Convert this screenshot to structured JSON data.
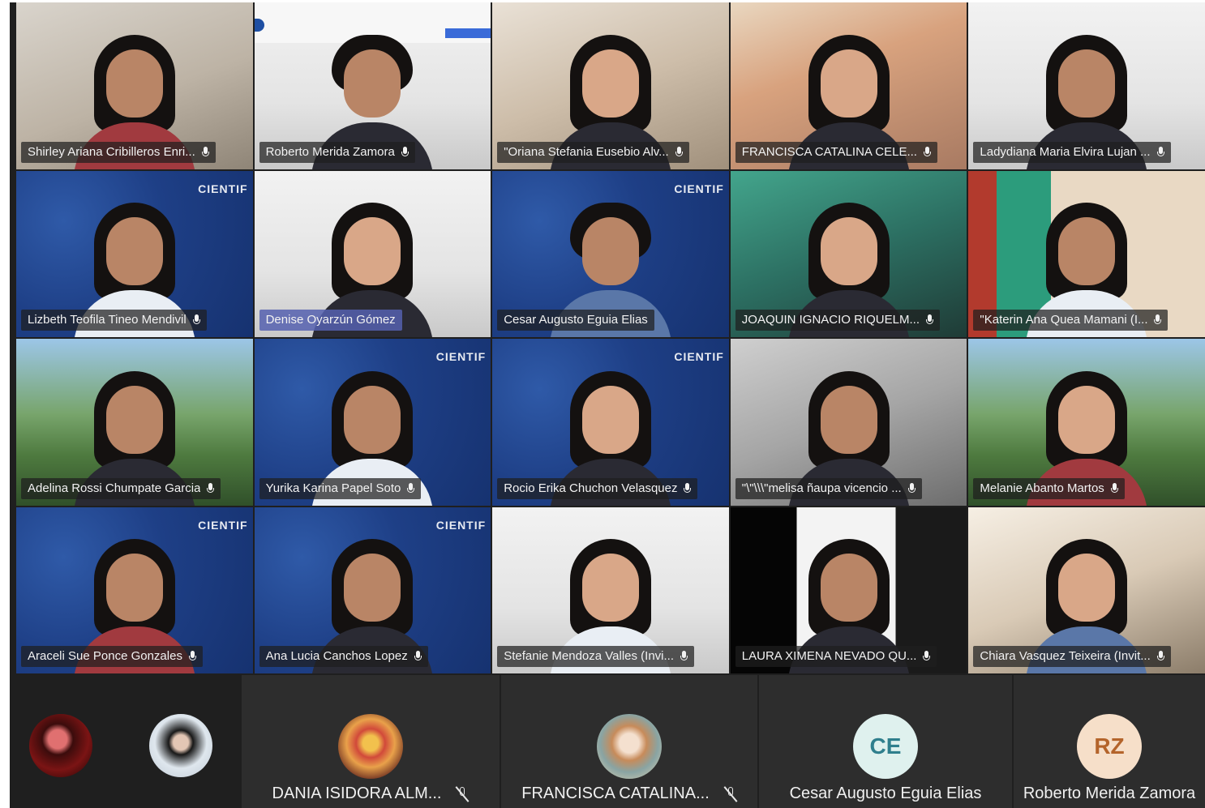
{
  "participants": [
    {
      "name": "Shirley Ariana Cribilleros Enri...",
      "highlight": false
    },
    {
      "name": "Roberto Merida Zamora",
      "highlight": false
    },
    {
      "name": "\"Oriana Stefania Eusebio Alv...",
      "highlight": false
    },
    {
      "name": "FRANCISCA CATALINA CELE...",
      "highlight": false
    },
    {
      "name": "Ladydiana Maria Elvira Lujan ...",
      "highlight": false
    },
    {
      "name": "Lizbeth Teofila Tineo Mendivil",
      "highlight": false
    },
    {
      "name": "Denise Oyarzún Gómez",
      "highlight": true
    },
    {
      "name": "Cesar Augusto Eguia Elias",
      "highlight": false
    },
    {
      "name": "JOAQUIN IGNACIO RIQUELM...",
      "highlight": false
    },
    {
      "name": "\"Katerin Ana Quea Mamani (I...",
      "highlight": false
    },
    {
      "name": "Adelina Rossi Chumpate Garcia",
      "highlight": false
    },
    {
      "name": "Yurika Karina Papel Soto",
      "highlight": false
    },
    {
      "name": "Rocio Erika Chuchon Velasquez",
      "highlight": false
    },
    {
      "name": "\"\\\"\\\\\\\"melisa ñaupa vicencio ...",
      "highlight": false
    },
    {
      "name": "Melanie Abanto Martos",
      "highlight": false
    },
    {
      "name": "Araceli Sue Ponce Gonzales",
      "highlight": false
    },
    {
      "name": "Ana Lucia Canchos Lopez",
      "highlight": false
    },
    {
      "name": "Stefanie Mendoza Valles (Invi...",
      "highlight": false
    },
    {
      "name": "LAURA XIMENA NEVADO QU...",
      "highlight": false
    },
    {
      "name": "Chiara Vasquez Teixeira (Invit...",
      "highlight": false
    }
  ],
  "background_brand": "CIENTIF",
  "bottom_strip": [
    {
      "name": "DANIA ISIDORA ALM...",
      "muted": true,
      "avatar": "photo"
    },
    {
      "name": "FRANCISCA CATALINA...",
      "muted": true,
      "avatar": "photo"
    },
    {
      "name": "Cesar Augusto Eguia Elias",
      "muted": false,
      "initials": "CE",
      "avatar_color": "#dff1ee",
      "initials_color": "#2f7f8d"
    },
    {
      "name": "Roberto Merida Zamora",
      "muted": false,
      "initials": "RZ",
      "avatar_color": "#f6dfc9",
      "initials_color": "#b4642b"
    }
  ],
  "colors": {
    "frame": "#1f1f1f",
    "tile_bar": "#2d2d2d",
    "label_highlight": "#5560af"
  }
}
